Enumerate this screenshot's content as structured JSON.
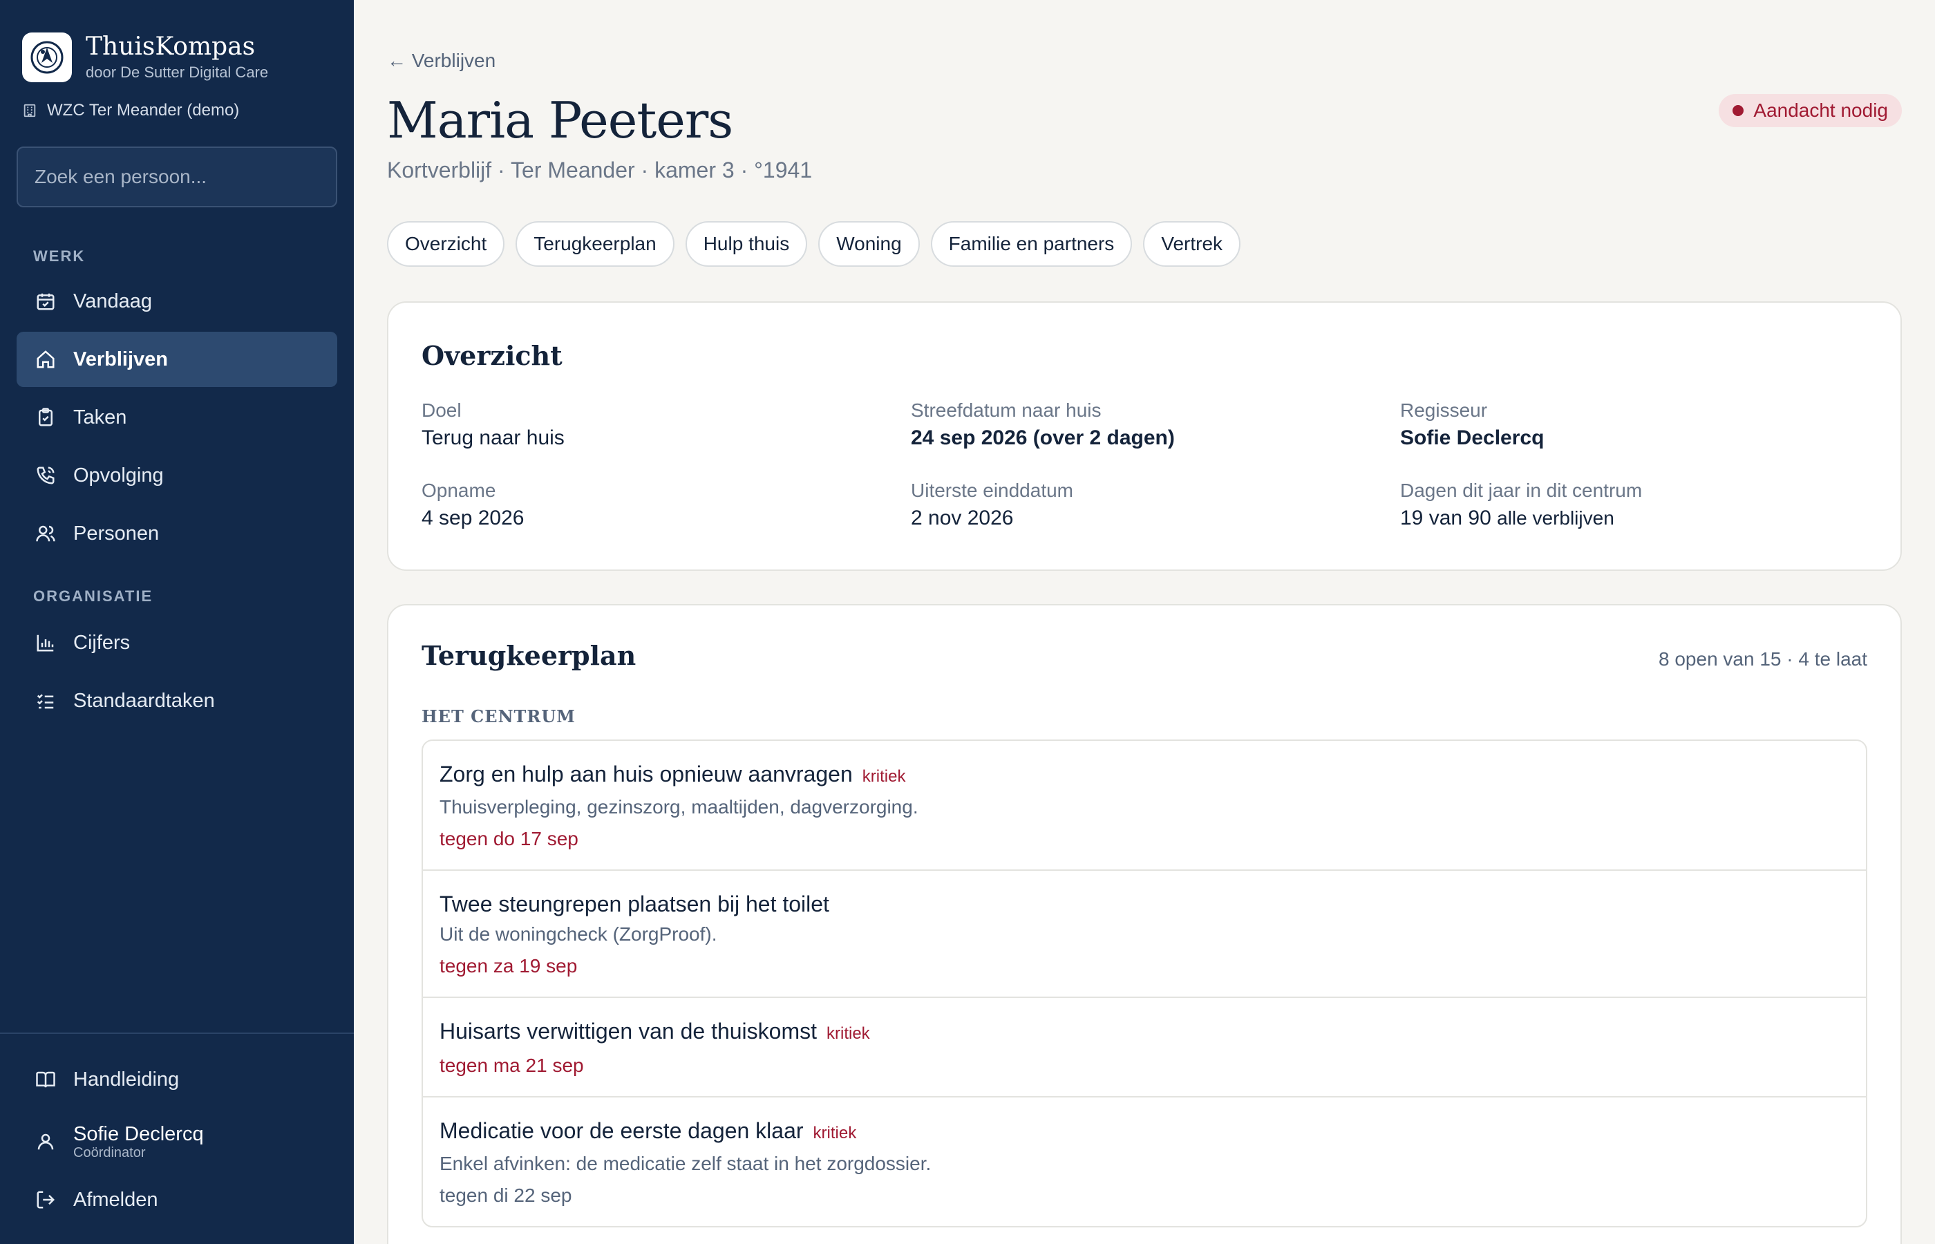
{
  "brand": {
    "name": "ThuisKompas",
    "sub": "door De Sutter Digital Care"
  },
  "org": "WZC Ter Meander (demo)",
  "search": {
    "placeholder": "Zoek een persoon..."
  },
  "sidebar": {
    "section_work": "WERK",
    "section_org": "ORGANISATIE",
    "items": [
      {
        "label": "Vandaag"
      },
      {
        "label": "Verblijven"
      },
      {
        "label": "Taken"
      },
      {
        "label": "Opvolging"
      },
      {
        "label": "Personen"
      },
      {
        "label": "Cijfers"
      },
      {
        "label": "Standaardtaken"
      }
    ],
    "manual": "Handleiding",
    "user": {
      "name": "Sofie Declercq",
      "role": "Coördinator"
    },
    "logout": "Afmelden"
  },
  "header": {
    "back": "← Verblijven",
    "title": "Maria Peeters",
    "subtitle": "Kortverblijf · Ter Meander · kamer 3 · °1941",
    "badge": "Aandacht nodig"
  },
  "tabs": [
    "Overzicht",
    "Terugkeerplan",
    "Hulp thuis",
    "Woning",
    "Familie en partners",
    "Vertrek"
  ],
  "overview": {
    "title": "Overzicht",
    "fields": [
      {
        "label": "Doel",
        "value": "Terug naar huis"
      },
      {
        "label": "Streefdatum naar huis",
        "value": "24 sep 2026 (over 2 dagen)"
      },
      {
        "label": "Regisseur",
        "value": "Sofie Declercq"
      },
      {
        "label": "Opname",
        "value": "4 sep 2026"
      },
      {
        "label": "Uiterste einddatum",
        "value": "2 nov 2026"
      },
      {
        "label": "Dagen dit jaar in dit centrum",
        "value": "19 van 90",
        "suffix": "alle verblijven"
      }
    ]
  },
  "plan": {
    "title": "Terugkeerplan",
    "meta": "8 open van 15 · 4 te laat",
    "group": "HET CENTRUM",
    "tasks": [
      {
        "title": "Zorg en hulp aan huis opnieuw aanvragen",
        "tag": "kritiek",
        "desc": "Thuisverpleging, gezinszorg, maaltijden, dagverzorging.",
        "due": "tegen do 17 sep"
      },
      {
        "title": "Twee steungrepen plaatsen bij het toilet",
        "desc": "Uit de woningcheck (ZorgProof).",
        "due": "tegen za 19 sep"
      },
      {
        "title": "Huisarts verwittigen van de thuiskomst",
        "tag": "kritiek",
        "due": "tegen ma 21 sep"
      },
      {
        "title": "Medicatie voor de eerste dagen klaar",
        "tag": "kritiek",
        "desc": "Enkel afvinken: de medicatie zelf staat in het zorgdossier.",
        "due": "tegen di 22 sep"
      }
    ]
  }
}
